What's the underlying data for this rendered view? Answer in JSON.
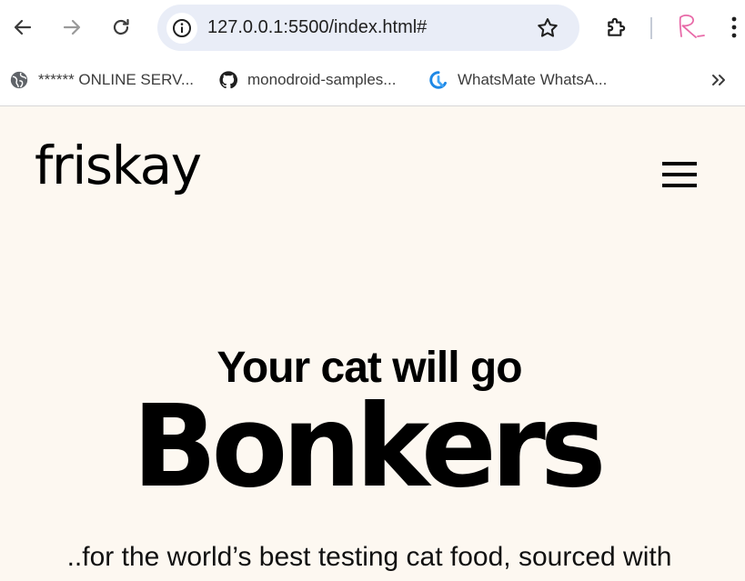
{
  "browser": {
    "url": "127.0.0.1:5500/index.html#",
    "profile_signature": "R."
  },
  "bookmarks": [
    {
      "label": "****** ONLINE SERV...",
      "icon": "globe-icon"
    },
    {
      "label": "monodroid-samples...",
      "icon": "github-icon"
    },
    {
      "label": "WhatsMate WhatsA...",
      "icon": "whatsmate-icon"
    }
  ],
  "page": {
    "logo": "friskay",
    "hero_subtitle": "Your cat will go",
    "hero_title": "Bonkers",
    "hero_description": "..for the world’s best testing cat food, sourced with"
  },
  "colors": {
    "page_background": "#fdf8f1",
    "omnibox_background": "#e9edf7",
    "text": "#000000",
    "profile_accent": "#e86aa8"
  }
}
